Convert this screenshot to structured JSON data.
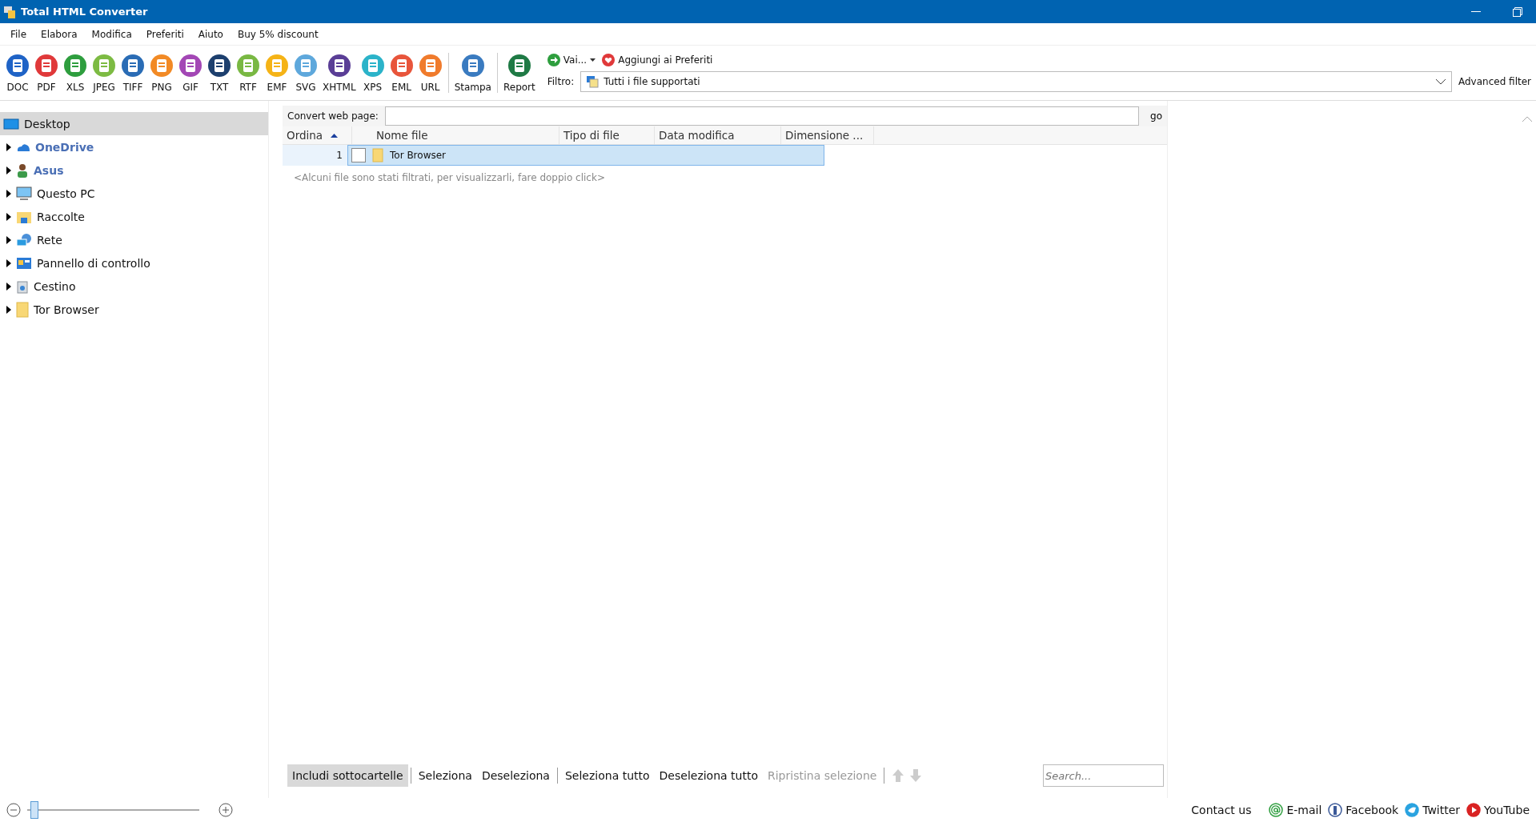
{
  "window": {
    "title": "Total HTML Converter"
  },
  "menu": [
    "File",
    "Elabora",
    "Modifica",
    "Preferiti",
    "Aiuto",
    "Buy 5% discount"
  ],
  "formats": [
    {
      "label": "DOC",
      "color": "#1f63c6"
    },
    {
      "label": "PDF",
      "color": "#e0393a"
    },
    {
      "label": "XLS",
      "color": "#2e9e3e"
    },
    {
      "label": "JPEG",
      "color": "#7dbb43"
    },
    {
      "label": "TIFF",
      "color": "#2a6cb5"
    },
    {
      "label": "PNG",
      "color": "#f28a25"
    },
    {
      "label": "GIF",
      "color": "#a347b5"
    },
    {
      "label": "TXT",
      "color": "#1d3f6e"
    },
    {
      "label": "RTF",
      "color": "#79b843"
    },
    {
      "label": "EMF",
      "color": "#f5b316"
    },
    {
      "label": "SVG",
      "color": "#5ea8dc"
    },
    {
      "label": "XHTML",
      "color": "#5a3e96"
    },
    {
      "label": "XPS",
      "color": "#2bb3c9"
    },
    {
      "label": "EML",
      "color": "#e8553b"
    },
    {
      "label": "URL",
      "color": "#f07b2c"
    }
  ],
  "actions": [
    {
      "label": "Stampa",
      "color": "#3a7bc0"
    },
    {
      "label": "Report",
      "color": "#1f7a45"
    }
  ],
  "goto": "Vai...",
  "favorites": "Aggiungi ai Preferiti",
  "filter": {
    "label": "Filtro:",
    "value": "Tutti i file supportati",
    "advanced": "Advanced filter"
  },
  "tree": {
    "label": "Desktop",
    "kind": "desktop",
    "selected": true,
    "children": [
      {
        "label": "OneDrive",
        "kind": "cloud",
        "selected": false,
        "collapsed": true
      },
      {
        "label": "Asus",
        "kind": "user",
        "selected": false,
        "collapsed": true
      },
      {
        "label": "Questo PC",
        "kind": "pc",
        "selected": false,
        "collapsed": true
      },
      {
        "label": "Raccolte",
        "kind": "library",
        "selected": false,
        "collapsed": true
      },
      {
        "label": "Rete",
        "kind": "network",
        "selected": false,
        "collapsed": true
      },
      {
        "label": "Pannello di controllo",
        "kind": "control",
        "selected": false,
        "collapsed": true
      },
      {
        "label": "Cestino",
        "kind": "bin",
        "selected": false,
        "collapsed": true
      },
      {
        "label": "Tor Browser",
        "kind": "folder",
        "selected": false,
        "collapsed": true
      }
    ]
  },
  "web": {
    "label": "Convert web page:",
    "button": "go"
  },
  "table": {
    "columns": [
      {
        "label": "Ordina",
        "sorted": true
      },
      {
        "label": "Nome file",
        "sorted": false
      },
      {
        "label": "Tipo di file",
        "sorted": false
      },
      {
        "label": "Data modifica",
        "sorted": false
      },
      {
        "label": "Dimensione ...",
        "sorted": false
      }
    ],
    "rows": [
      {
        "index": "1",
        "name": "Tor Browser",
        "checked": false,
        "selected": true
      }
    ],
    "note": "<Alcuni file sono stati filtrati, per visualizzarli, fare doppio click>"
  },
  "bottom": {
    "buttons": [
      {
        "label": "Includi sottocartelle",
        "on": true,
        "disabled": false
      },
      {
        "label": "Seleziona",
        "on": false,
        "disabled": false
      },
      {
        "label": "Deseleziona",
        "on": false,
        "disabled": false
      },
      {
        "label": "Seleziona tutto",
        "on": false,
        "disabled": false
      },
      {
        "label": "Deseleziona tutto",
        "on": false,
        "disabled": false
      },
      {
        "label": "Ripristina selezione",
        "on": false,
        "disabled": true
      }
    ],
    "search": {
      "placeholder": "Search..."
    }
  },
  "zoom": {
    "level": 0.02
  },
  "contact": "Contact us",
  "links": [
    {
      "label": "E-mail",
      "kind": "email",
      "color": "#2e9e3e"
    },
    {
      "label": "Facebook",
      "kind": "facebook",
      "color": "#3b5998"
    },
    {
      "label": "Twitter",
      "kind": "twitter",
      "color": "#2aa3e0"
    },
    {
      "label": "YouTube",
      "kind": "youtube",
      "color": "#d92323"
    }
  ]
}
